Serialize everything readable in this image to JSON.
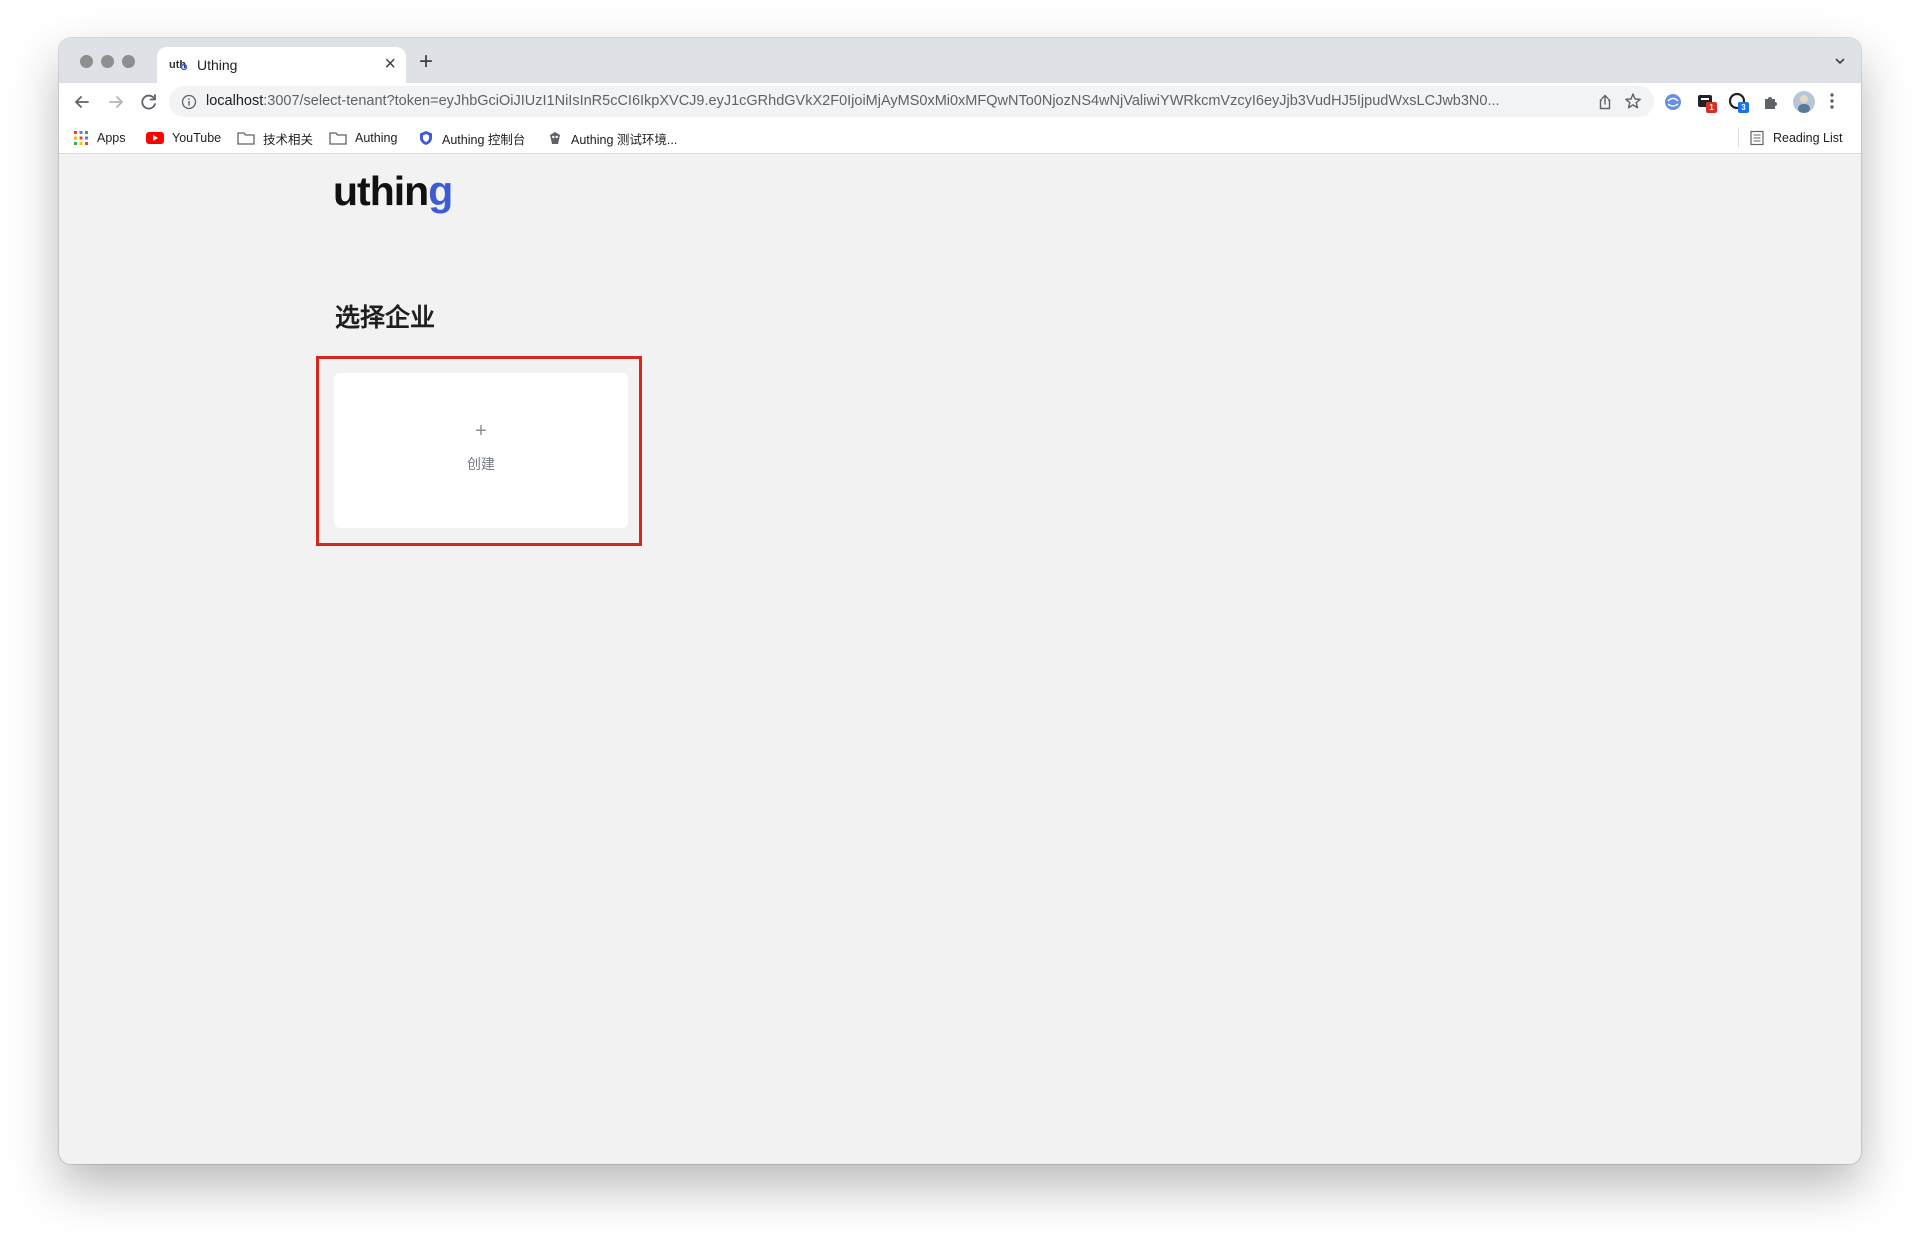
{
  "browser": {
    "tab": {
      "title": "Uthing",
      "close_glyph": "×",
      "favicon": "uthing-favicon-icon"
    },
    "new_tab_glyph": "+",
    "url": {
      "host": "localhost",
      "rest": ":3007/select-tenant?token=eyJhbGciOiJIUzI1NiIsInR5cCI6IkpXVCJ9.eyJ1cGRhdGVkX2F0IjoiMjAyMS0xMi0xMFQwNTo0NjozNS4wNjValiwiYWRkcmVzcyI6eyJjb3VudHJ5IjpudWxsLCJwb3N0..."
    },
    "extensions": {
      "ext2_badge": "1",
      "ext3_badge": "3"
    }
  },
  "bookmarks": {
    "apps": "Apps",
    "youtube": "YouTube",
    "tech": "技术相关",
    "authing": "Authing",
    "console": "Authing 控制台",
    "test_env": "Authing 测试环境...",
    "reading_list": "Reading List"
  },
  "page": {
    "logo": {
      "main": "uthin",
      "accent": "g"
    },
    "title": "选择企业",
    "create_card": {
      "plus": "+",
      "label": "创建"
    }
  },
  "colors": {
    "highlight_border": "#d9261c",
    "logo_accent": "#3c5bd6",
    "page_background": "#f2f2f2"
  }
}
